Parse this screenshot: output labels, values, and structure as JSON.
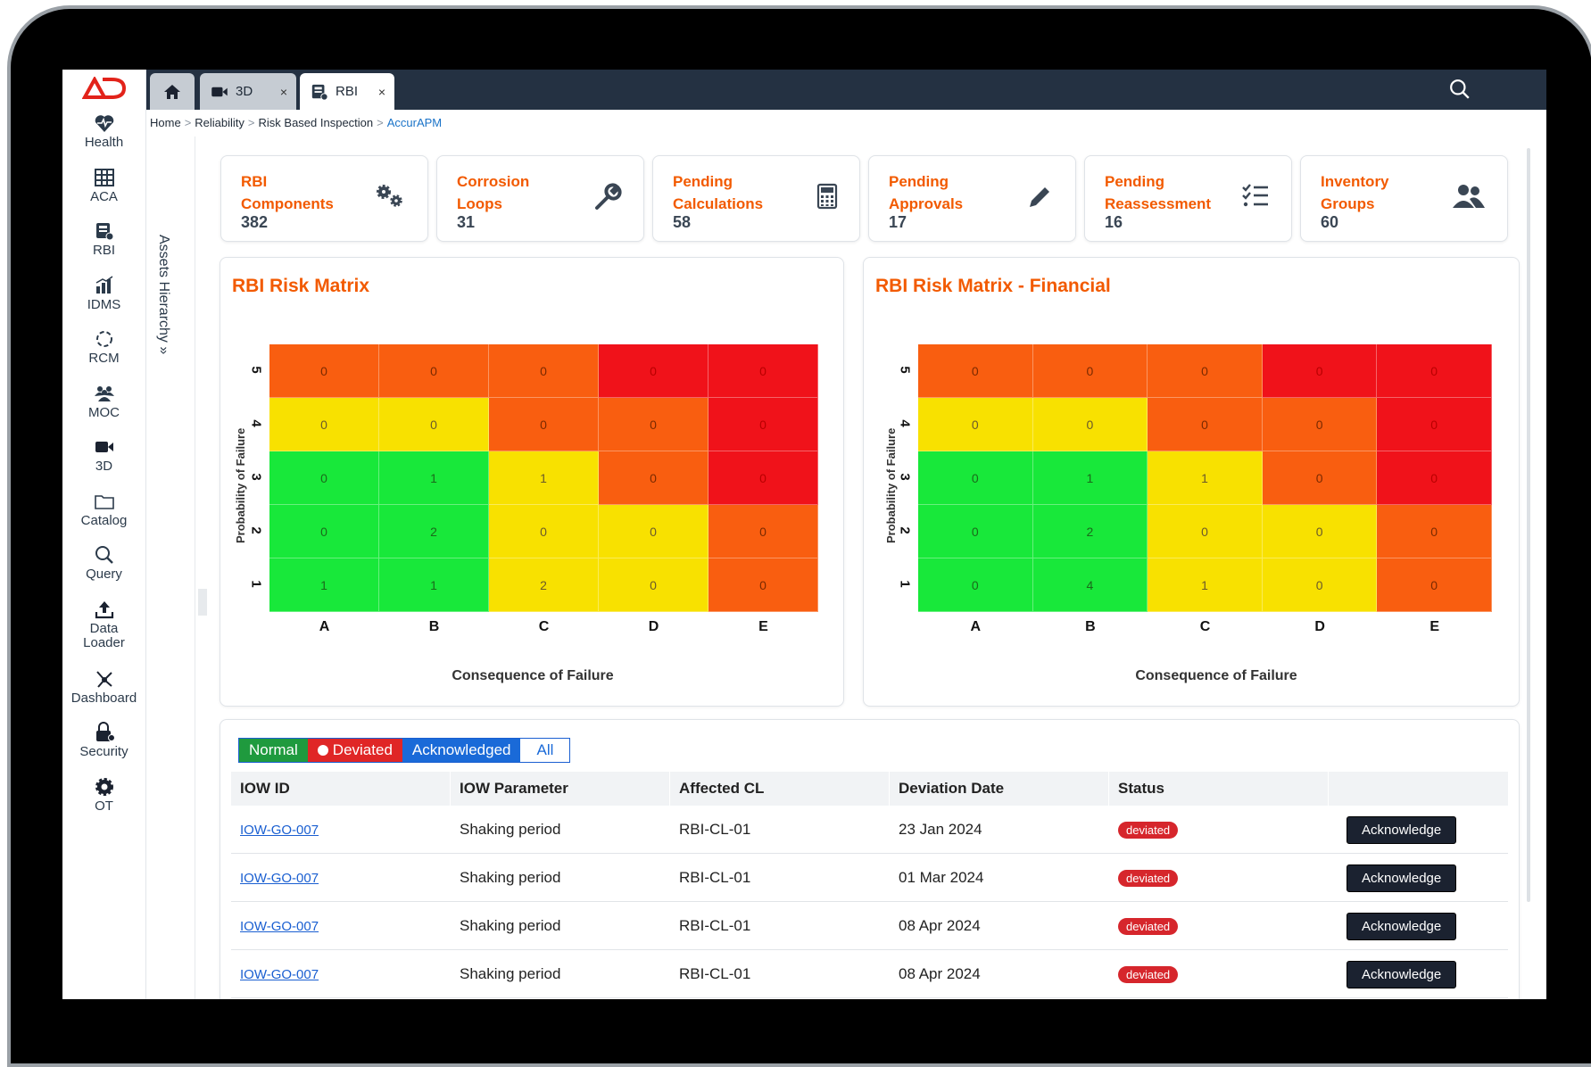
{
  "sidebar": {
    "logo_text": "AD",
    "items": [
      {
        "label": "Health",
        "icon": "heart-pulse-icon"
      },
      {
        "label": "ACA",
        "icon": "grid-icon"
      },
      {
        "label": "RBI",
        "icon": "rbi-icon"
      },
      {
        "label": "IDMS",
        "icon": "bar-chart-icon"
      },
      {
        "label": "RCM",
        "icon": "cycle-icon"
      },
      {
        "label": "MOC",
        "icon": "people-icon"
      },
      {
        "label": "3D",
        "icon": "video-icon"
      },
      {
        "label": "Catalog",
        "icon": "folder-icon"
      },
      {
        "label": "Query",
        "icon": "search-icon"
      },
      {
        "label": "Data Loader",
        "icon": "upload-icon"
      },
      {
        "label": "Dashboard",
        "icon": "network-icon"
      },
      {
        "label": "Security",
        "icon": "lock-icon"
      },
      {
        "label": "OT",
        "icon": "gear-icon"
      }
    ]
  },
  "tabs": [
    {
      "label": "",
      "icon": "home-icon"
    },
    {
      "label": "3D",
      "icon": "video-icon",
      "close": "×"
    },
    {
      "label": "RBI",
      "icon": "rbi-icon",
      "close": "×"
    }
  ],
  "breadcrumb": [
    "Home",
    "Reliability",
    "Risk Based Inspection",
    "AccurAPM"
  ],
  "assets_hierarchy_label": "Assets Hierarchy",
  "assets_hierarchy_chevron": "»",
  "cards": [
    {
      "line1": "RBI",
      "line2": "Components",
      "value": "382",
      "icon": "gears-icon"
    },
    {
      "line1": "Corrosion",
      "line2": "Loops",
      "value": "31",
      "icon": "wrench-icon"
    },
    {
      "line1": "Pending",
      "line2": "Calculations",
      "value": "58",
      "icon": "calculator-icon"
    },
    {
      "line1": "Pending",
      "line2": "Approvals",
      "value": "17",
      "icon": "pencil-icon"
    },
    {
      "line1": "Pending",
      "line2": "Reassessment",
      "value": "16",
      "icon": "checklist-icon"
    },
    {
      "line1": "Inventory",
      "line2": "Groups",
      "value": "60",
      "icon": "users-icon"
    }
  ],
  "colors": {
    "green": "#18e83a",
    "yellow": "#f8e100",
    "orange": "#f95e10",
    "red": "#f0121a",
    "accent": "#f25a00"
  },
  "chart_data": [
    {
      "type": "heatmap",
      "title": "RBI Risk Matrix",
      "xlabel": "Consequence of Failure",
      "ylabel": "Probability of Failure",
      "x_categories": [
        "A",
        "B",
        "C",
        "D",
        "E"
      ],
      "y_categories": [
        "5",
        "4",
        "3",
        "2",
        "1"
      ],
      "values": [
        [
          0,
          0,
          0,
          0,
          0
        ],
        [
          0,
          0,
          0,
          0,
          0
        ],
        [
          0,
          1,
          1,
          0,
          0
        ],
        [
          0,
          2,
          0,
          0,
          0
        ],
        [
          1,
          1,
          2,
          0,
          0
        ]
      ],
      "risk_levels": [
        [
          "orange",
          "orange",
          "orange",
          "red",
          "red"
        ],
        [
          "yellow",
          "yellow",
          "orange",
          "orange",
          "red"
        ],
        [
          "green",
          "green",
          "yellow",
          "orange",
          "red"
        ],
        [
          "green",
          "green",
          "yellow",
          "yellow",
          "orange"
        ],
        [
          "green",
          "green",
          "yellow",
          "yellow",
          "orange"
        ]
      ]
    },
    {
      "type": "heatmap",
      "title": "RBI Risk Matrix - Financial",
      "xlabel": "Consequence of Failure",
      "ylabel": "Probability of Failure",
      "x_categories": [
        "A",
        "B",
        "C",
        "D",
        "E"
      ],
      "y_categories": [
        "5",
        "4",
        "3",
        "2",
        "1"
      ],
      "values": [
        [
          0,
          0,
          0,
          0,
          0
        ],
        [
          0,
          0,
          0,
          0,
          0
        ],
        [
          0,
          1,
          1,
          0,
          0
        ],
        [
          0,
          2,
          0,
          0,
          0
        ],
        [
          0,
          4,
          1,
          0,
          0
        ]
      ],
      "risk_levels": [
        [
          "orange",
          "orange",
          "orange",
          "red",
          "red"
        ],
        [
          "yellow",
          "yellow",
          "orange",
          "orange",
          "red"
        ],
        [
          "green",
          "green",
          "yellow",
          "orange",
          "red"
        ],
        [
          "green",
          "green",
          "yellow",
          "yellow",
          "orange"
        ],
        [
          "green",
          "green",
          "yellow",
          "yellow",
          "orange"
        ]
      ]
    }
  ],
  "filters": [
    "Normal",
    "Deviated",
    "Acknowledged",
    "All"
  ],
  "table": {
    "columns": [
      "IOW ID",
      "IOW Parameter",
      "Affected CL",
      "Deviation Date",
      "Status",
      ""
    ],
    "rows": [
      {
        "id": "IOW-GO-007",
        "param": "Shaking period",
        "cl": "RBI-CL-01",
        "date": "23 Jan 2024",
        "status": "deviated",
        "action": "Acknowledge"
      },
      {
        "id": "IOW-GO-007",
        "param": "Shaking period",
        "cl": "RBI-CL-01",
        "date": "01 Mar 2024",
        "status": "deviated",
        "action": "Acknowledge"
      },
      {
        "id": "IOW-GO-007",
        "param": "Shaking period",
        "cl": "RBI-CL-01",
        "date": "08 Apr 2024",
        "status": "deviated",
        "action": "Acknowledge"
      },
      {
        "id": "IOW-GO-007",
        "param": "Shaking period",
        "cl": "RBI-CL-01",
        "date": "08 Apr 2024",
        "status": "deviated",
        "action": "Acknowledge"
      }
    ]
  }
}
